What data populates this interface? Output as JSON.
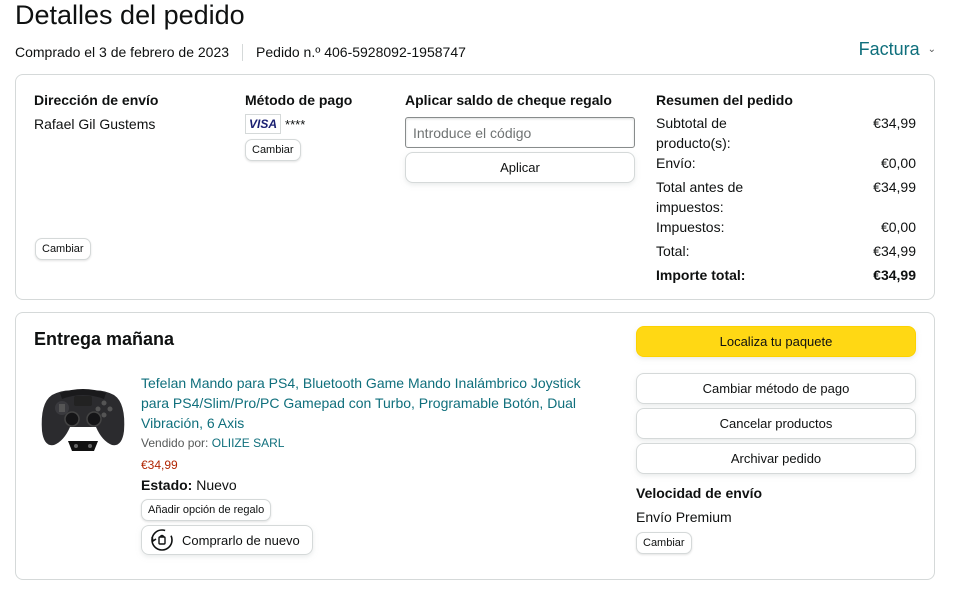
{
  "header": {
    "title": "Detalles del pedido",
    "purchased": "Comprado el 3 de febrero de 2023",
    "order_number": "Pedido n.º 406-5928092-1958747",
    "invoice_label": "Factura"
  },
  "shipping_address": {
    "heading": "Dirección de envío",
    "name": "Rafael Gil Gustems",
    "change_label": "Cambiar"
  },
  "payment_method": {
    "heading": "Método de pago",
    "card_brand": "VISA",
    "card_mask": "****",
    "change_label": "Cambiar"
  },
  "gift_card": {
    "heading": "Aplicar saldo de cheque regalo",
    "placeholder": "Introduce el código",
    "apply_label": "Aplicar"
  },
  "summary": {
    "heading": "Resumen del pedido",
    "rows": [
      {
        "label": "Subtotal de producto(s):",
        "value": "€34,99"
      },
      {
        "label": "Envío:",
        "value": "€0,00"
      },
      {
        "label": "Total antes de impuestos:",
        "value": "€34,99"
      },
      {
        "label": "Impuestos:",
        "value": "€0,00"
      },
      {
        "label": "Total:",
        "value": "€34,99"
      },
      {
        "label": "Importe total:",
        "value": "€34,99"
      }
    ]
  },
  "delivery": {
    "heading": "Entrega mañana",
    "product_title": "Tefelan Mando para PS4, Bluetooth Game Mando Inalámbrico Joystick para PS4/Slim/Pro/PC Gamepad con Turbo, Programable Botón, Dual Vibración, 6 Axis",
    "sold_by_label": "Vendido por:",
    "seller": "OLIIZE SARL",
    "price": "€34,99",
    "condition_label": "Estado:",
    "condition": "Nuevo",
    "gift_option_label": "Añadir opción de regalo",
    "buy_again_label": "Comprarlo de nuevo"
  },
  "actions": {
    "track": "Localiza tu paquete",
    "change_payment": "Cambiar método de pago",
    "cancel": "Cancelar productos",
    "archive": "Archivar pedido"
  },
  "shipping_speed": {
    "heading": "Velocidad de envío",
    "value": "Envío Premium",
    "change_label": "Cambiar"
  },
  "colors": {
    "link": "#0f6f7c",
    "price": "#b12704",
    "primary_button": "#ffd814",
    "border": "#d5d9d9"
  },
  "icons": {
    "invoice_dropdown": "chevron-down-icon",
    "buy_again": "buy-again-icon",
    "product": "game-controller-image"
  }
}
